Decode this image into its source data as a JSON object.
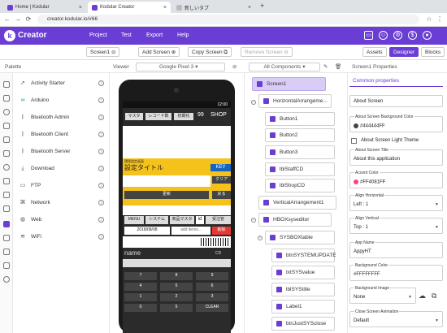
{
  "browser": {
    "tabs": [
      {
        "label": "Home | Kodular",
        "color": "#6a3dd4"
      },
      {
        "label": "Kodular Creator",
        "color": "#6a3dd4"
      },
      {
        "label": "新しいタブ",
        "color": "#9e9e9e"
      }
    ],
    "new_tab": "+",
    "url": "creator.kodular.io/#66"
  },
  "app": {
    "brand": "Creator",
    "menu": [
      "Project",
      "Test",
      "Export",
      "Help"
    ]
  },
  "toolbar": {
    "screen": "Screen1",
    "add_screen": "Add Screen",
    "copy_screen": "Copy Screen",
    "remove_screen": "Remove Screen",
    "assets": "Assets",
    "designer": "Designer",
    "blocks": "Blocks"
  },
  "palette": {
    "title": "Palette",
    "items": [
      {
        "label": "Activity Starter",
        "icon": "rocket-icon"
      },
      {
        "label": "Arduino",
        "icon": "arduino-icon"
      },
      {
        "label": "Bluetooth Admin",
        "icon": "bluetooth-icon"
      },
      {
        "label": "Bluetooth Client",
        "icon": "bluetooth-icon"
      },
      {
        "label": "Bluetooth Server",
        "icon": "bluetooth-icon"
      },
      {
        "label": "Download",
        "icon": "download-icon"
      },
      {
        "label": "FTP",
        "icon": "folder-icon"
      },
      {
        "label": "Network",
        "icon": "network-icon"
      },
      {
        "label": "Web",
        "icon": "globe-icon"
      },
      {
        "label": "WiFi",
        "icon": "wifi-icon"
      }
    ]
  },
  "viewer": {
    "title": "Viewer",
    "device": "Google Pixel 3",
    "phone": {
      "time": "12:00",
      "buttons": [
        "マスタ",
        "レコード数",
        "初期化"
      ],
      "count": "99",
      "shop": "SHOP",
      "header_small": "環境設定画面",
      "header_big": "設定タイトル",
      "key": "KEY",
      "clear": "クリア",
      "update": "更新",
      "back": "戻る",
      "tabs": [
        "MENU",
        "システム",
        "商品マスタ",
        "id",
        "受注管"
      ],
      "date": "2018/08/08",
      "items": "add items...",
      "delete": "削除",
      "name": "name",
      "cd": "CD",
      "keys": [
        [
          "7",
          "8",
          "9"
        ],
        [
          "4",
          "5",
          "6"
        ],
        [
          "1",
          "2",
          "3"
        ],
        [
          "0",
          "5",
          "CLEAR"
        ]
      ]
    }
  },
  "components": {
    "title": "All Components",
    "items": [
      "Screen1",
      "HorizontalArrangeme...",
      "Button1",
      "Button2",
      "Button3",
      "lblStaffCD",
      "lblShopCD",
      "VerticalArrangement1",
      "HBOXsyseditor",
      "SYSBOXtable",
      "btnSYSTEMUPDATE",
      "txtSYSvalue",
      "lblSYStitle",
      "Label1",
      "btnJustSYSclose"
    ]
  },
  "properties": {
    "title": "Screen1 Properties",
    "common": "Common properties",
    "about_screen": "About Screen",
    "bg_color_label": "About Screen Background Color",
    "bg_color_value": "#444444FF",
    "light_theme": "About Screen Light Theme",
    "about_title_label": "About Screen Title",
    "about_title_value": "About this application",
    "accent_label": "Accent Color",
    "accent_value": "#FF4081FF",
    "align_h_label": "Align Horizontal",
    "align_h_value": "Left : 1",
    "align_v_label": "Align Vertical",
    "align_v_value": "Top : 1",
    "app_name_label": "App Name",
    "app_name_value": "AppyHT",
    "bg_label": "Background Color",
    "bg_value": "#FFFFFFFF",
    "bg_image_label": "Background Image",
    "bg_image_value": "None",
    "close_anim_label": "Close Screen Animation",
    "close_anim_value": "Default"
  },
  "colors": {
    "brand": "#6a3dd4",
    "accent": "#FF4081",
    "dark": "#444444",
    "yellow": "#f5c21b"
  }
}
